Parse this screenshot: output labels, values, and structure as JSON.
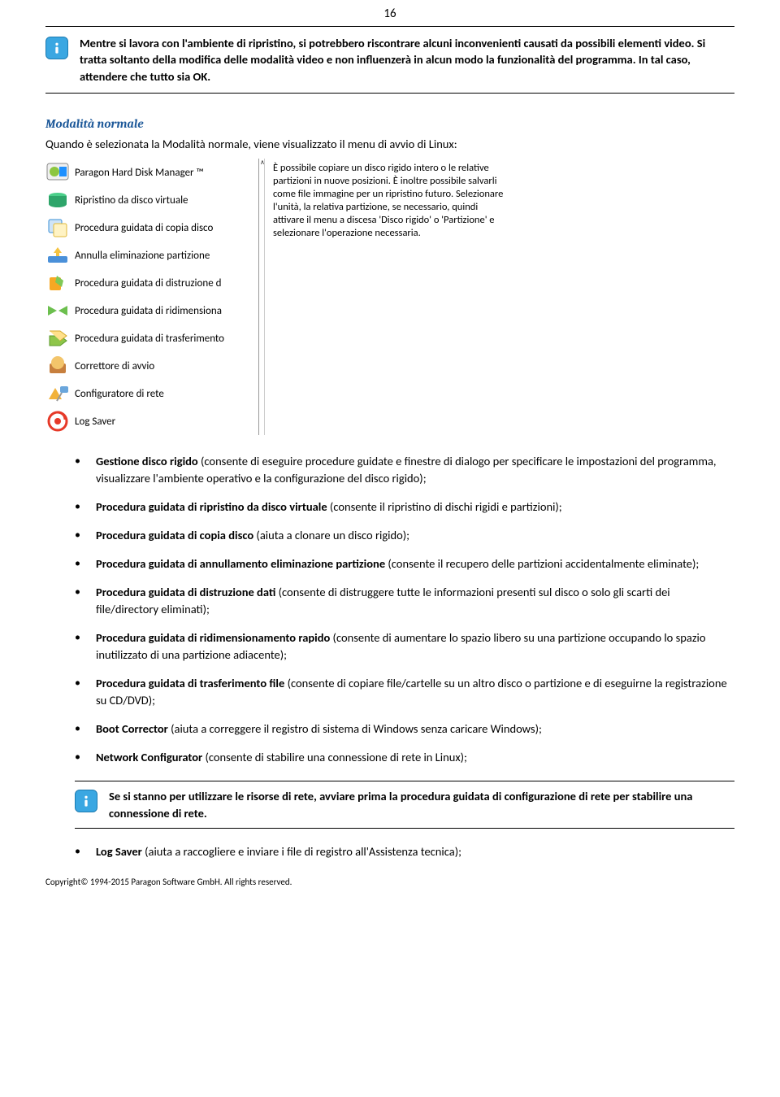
{
  "page_number": "16",
  "callout1": "Mentre si lavora con l'ambiente di ripristino, si potrebbero riscontrare alcuni inconvenienti causati da possibili elementi video. Si tratta soltanto della modifica delle modalità video e non influenzerà in alcun modo la funzionalità del programma. In tal caso, attendere che tutto sia OK.",
  "section_title": "Modalità normale",
  "intro": "Quando è selezionata la Modalità normale, viene visualizzato il menu di avvio di Linux:",
  "menu": {
    "items": [
      {
        "label": "Paragon Hard Disk Manager ™"
      },
      {
        "label": "Ripristino da disco virtuale"
      },
      {
        "label": "Procedura guidata di copia disco"
      },
      {
        "label": "Annulla eliminazione partizione"
      },
      {
        "label": "Procedura guidata di distruzione d"
      },
      {
        "label": "Procedura guidata di ridimensiona"
      },
      {
        "label": "Procedura guidata di trasferimento"
      },
      {
        "label": "Correttore di avvio"
      },
      {
        "label": "Configuratore di rete"
      },
      {
        "label": "Log Saver"
      }
    ],
    "description": "È possibile copiare un disco rigido intero o le relative partizioni in nuove posizioni. È inoltre possibile salvarli come file immagine per un ripristino futuro. Selezionare l'unità, la relativa partizione, se necessario, quindi attivare il menu a discesa 'Disco rigido' o 'Partizione' e selezionare l'operazione necessaria."
  },
  "bullets": [
    {
      "b": "Gestione disco rigido",
      "t": " (consente di eseguire procedure guidate e finestre di dialogo per specificare le impostazioni del programma, visualizzare l'ambiente operativo e la configurazione del disco rigido);"
    },
    {
      "b": "Procedura guidata di ripristino da disco virtuale",
      "t": " (consente il ripristino di dischi rigidi e partizioni);"
    },
    {
      "b": "Procedura guidata di copia disco",
      "t": " (aiuta a clonare un disco rigido);"
    },
    {
      "b": "Procedura guidata di annullamento eliminazione partizione",
      "t": " (consente il recupero delle partizioni accidentalmente eliminate);"
    },
    {
      "b": "Procedura guidata di distruzione dati",
      "t": " (consente di distruggere tutte le informazioni presenti sul disco o solo gli scarti dei file/directory eliminati);"
    },
    {
      "b": "Procedura guidata di ridimensionamento rapido",
      "t": " (consente di aumentare lo spazio libero su una partizione occupando lo spazio inutilizzato di una partizione adiacente);"
    },
    {
      "b": "Procedura guidata di trasferimento file",
      "t": " (consente di copiare file/cartelle su un altro disco o partizione e di eseguirne la registrazione su CD/DVD);"
    },
    {
      "b": "Boot Corrector",
      "t": " (aiuta a correggere il registro di sistema di Windows senza caricare Windows);"
    },
    {
      "b": "Network Configurator",
      "t": " (consente di stabilire una connessione di rete in Linux);"
    }
  ],
  "callout2": "Se si stanno per utilizzare le risorse di rete, avviare prima la procedura guidata di configurazione di rete per stabilire una connessione di rete.",
  "bullet_last": {
    "b": "Log Saver",
    "t": " (aiuta a raccogliere e inviare i file di registro all'Assistenza tecnica);"
  },
  "footer": "Copyright© 1994-2015 Paragon Software GmbH. All rights reserved."
}
